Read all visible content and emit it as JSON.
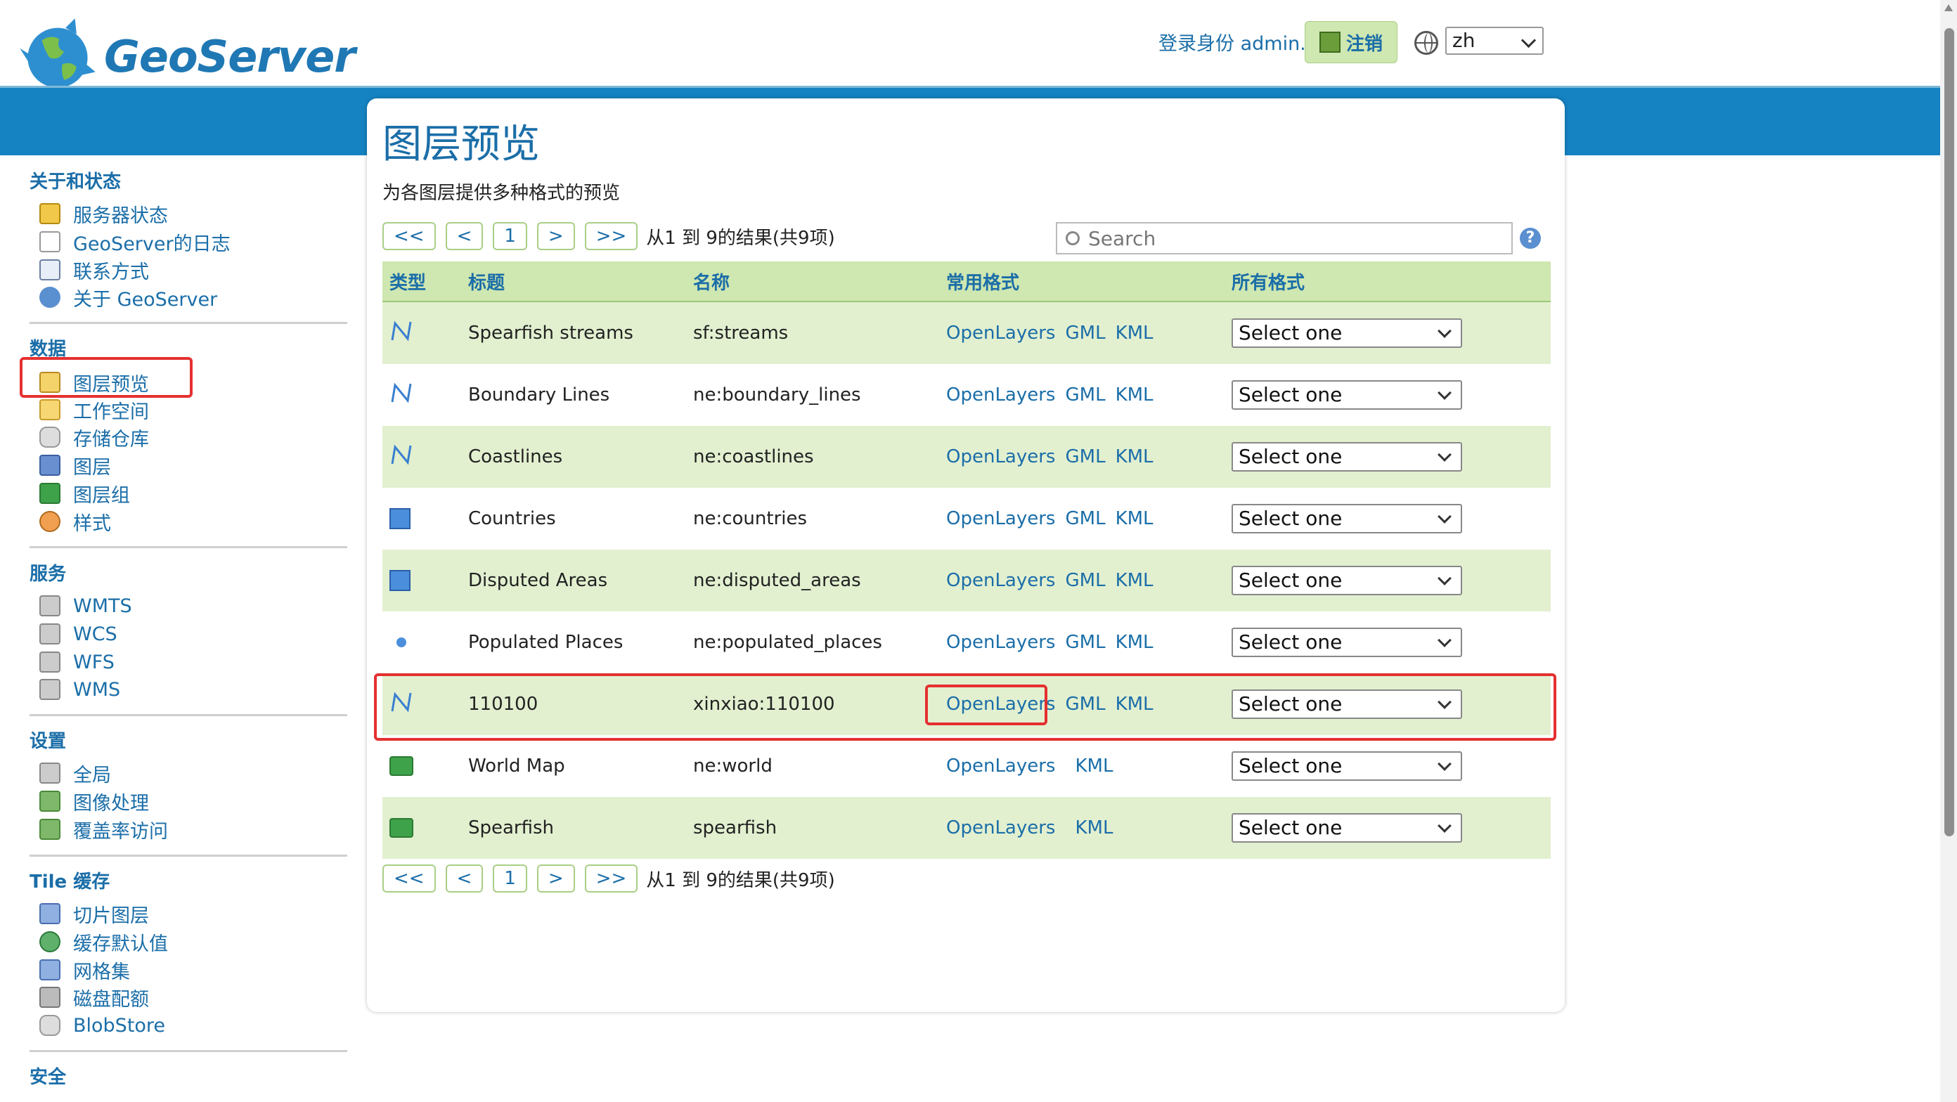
{
  "app": {
    "name": "GeoServer"
  },
  "header": {
    "login_text": "登录身份 admin.",
    "logout_label": "注销",
    "language": "zh"
  },
  "sidebar": {
    "sections": [
      {
        "title": "关于和状态",
        "items": [
          "服务器状态",
          "GeoServer的日志",
          "联系方式",
          "关于 GeoServer"
        ]
      },
      {
        "title": "数据",
        "items": [
          "图层预览",
          "工作空间",
          "存储仓库",
          "图层",
          "图层组",
          "样式"
        ]
      },
      {
        "title": "服务",
        "items": [
          "WMTS",
          "WCS",
          "WFS",
          "WMS"
        ]
      },
      {
        "title": "设置",
        "items": [
          "全局",
          "图像处理",
          "覆盖率访问"
        ]
      },
      {
        "title": "Tile 缓存",
        "items": [
          "切片图层",
          "缓存默认值",
          "网格集",
          "磁盘配额",
          "BlobStore"
        ]
      },
      {
        "title": "安全",
        "items": []
      }
    ]
  },
  "main": {
    "title": "图层预览",
    "description": "为各图层提供多种格式的预览",
    "pager": {
      "first": "<<",
      "prev": "<",
      "page": "1",
      "next": ">",
      "last": ">>",
      "summary": "从1 到 9的结果(共9项)"
    },
    "search_placeholder": "Search",
    "help": "?",
    "columns": [
      "类型",
      "标题",
      "名称",
      "常用格式",
      "所有格式"
    ],
    "rows": [
      {
        "type": "line",
        "title": "Spearfish streams",
        "name": "sf:streams",
        "formats": [
          "OpenLayers",
          "GML",
          "KML"
        ],
        "all_formats": "Select one"
      },
      {
        "type": "line",
        "title": "Boundary Lines",
        "name": "ne:boundary_lines",
        "formats": [
          "OpenLayers",
          "GML",
          "KML"
        ],
        "all_formats": "Select one"
      },
      {
        "type": "line",
        "title": "Coastlines",
        "name": "ne:coastlines",
        "formats": [
          "OpenLayers",
          "GML",
          "KML"
        ],
        "all_formats": "Select one"
      },
      {
        "type": "polygon",
        "title": "Countries",
        "name": "ne:countries",
        "formats": [
          "OpenLayers",
          "GML",
          "KML"
        ],
        "all_formats": "Select one"
      },
      {
        "type": "polygon",
        "title": "Disputed Areas",
        "name": "ne:disputed_areas",
        "formats": [
          "OpenLayers",
          "GML",
          "KML"
        ],
        "all_formats": "Select one"
      },
      {
        "type": "point",
        "title": "Populated Places",
        "name": "ne:populated_places",
        "formats": [
          "OpenLayers",
          "GML",
          "KML"
        ],
        "all_formats": "Select one"
      },
      {
        "type": "line",
        "title": "110100",
        "name": "xinxiao:110100",
        "formats": [
          "OpenLayers",
          "GML",
          "KML"
        ],
        "all_formats": "Select one"
      },
      {
        "type": "group",
        "title": "World Map",
        "name": "ne:world",
        "formats": [
          "OpenLayers",
          "",
          "KML"
        ],
        "all_formats": "Select one"
      },
      {
        "type": "group",
        "title": "Spearfish",
        "name": "spearfish",
        "formats": [
          "OpenLayers",
          "",
          "KML"
        ],
        "all_formats": "Select one"
      }
    ]
  },
  "colors": {
    "brand_blue": "#1583c1",
    "link": "#1b6ea8",
    "row_green": "#e2f0d0",
    "highlight_red": "#e53030"
  }
}
